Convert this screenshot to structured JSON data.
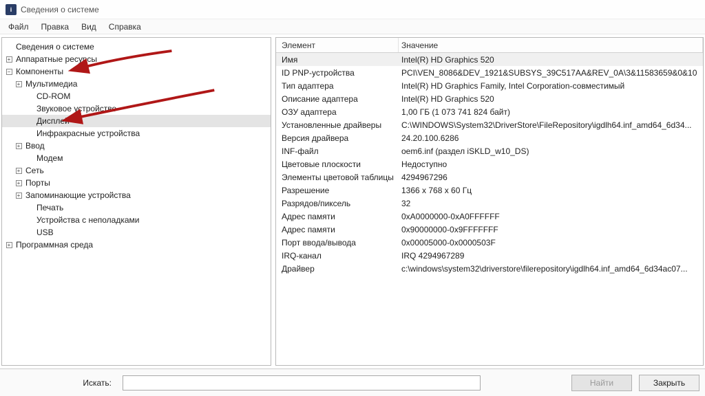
{
  "window": {
    "title": "Сведения о системе"
  },
  "menubar": {
    "file": "Файл",
    "edit": "Правка",
    "view": "Вид",
    "help": "Справка"
  },
  "tree": {
    "root": "Сведения о системе",
    "hardware": "Аппаратные ресурсы",
    "components": "Компоненты",
    "multimedia": "Мультимедиа",
    "cdrom": "CD-ROM",
    "sound": "Звуковое устройство",
    "display": "Дисплей",
    "infrared": "Инфракрасные устройства",
    "input": "Ввод",
    "modem": "Модем",
    "network": "Сеть",
    "ports": "Порты",
    "storage": "Запоминающие устройства",
    "printing": "Печать",
    "problem_devices": "Устройства с неполадками",
    "usb": "USB",
    "software_env": "Программная среда"
  },
  "detail": {
    "header_element": "Элемент",
    "header_value": "Значение",
    "rows": [
      {
        "name": "Имя",
        "value": "Intel(R) HD Graphics 520"
      },
      {
        "name": "ID PNP-устройства",
        "value": "PCI\\VEN_8086&DEV_1921&SUBSYS_39C517AA&REV_0A\\3&11583659&0&10"
      },
      {
        "name": "Тип адаптера",
        "value": "Intel(R) HD Graphics Family, Intel Corporation-совместимый"
      },
      {
        "name": "Описание адаптера",
        "value": "Intel(R) HD Graphics 520"
      },
      {
        "name": "ОЗУ адаптера",
        "value": "1,00 ГБ (1 073 741 824 байт)"
      },
      {
        "name": "Установленные драйверы",
        "value": "C:\\WINDOWS\\System32\\DriverStore\\FileRepository\\igdlh64.inf_amd64_6d34..."
      },
      {
        "name": "Версия драйвера",
        "value": "24.20.100.6286"
      },
      {
        "name": "INF-файл",
        "value": "oem6.inf (раздел iSKLD_w10_DS)"
      },
      {
        "name": "Цветовые плоскости",
        "value": "Недоступно"
      },
      {
        "name": "Элементы цветовой таблицы",
        "value": "4294967296"
      },
      {
        "name": "Разрешение",
        "value": "1366 x 768 x 60 Гц"
      },
      {
        "name": "Разрядов/пиксель",
        "value": "32"
      },
      {
        "name": "Адрес памяти",
        "value": "0xA0000000-0xA0FFFFFF"
      },
      {
        "name": "Адрес памяти",
        "value": "0x90000000-0x9FFFFFFF"
      },
      {
        "name": "Порт ввода/вывода",
        "value": "0x00005000-0x0000503F"
      },
      {
        "name": "IRQ-канал",
        "value": "IRQ 4294967289"
      },
      {
        "name": "Драйвер",
        "value": "c:\\windows\\system32\\driverstore\\filerepository\\igdlh64.inf_amd64_6d34ac07..."
      }
    ]
  },
  "footer": {
    "search_label": "Искать:",
    "search_value": "",
    "search_placeholder": "",
    "find_button": "Найти",
    "close_button": "Закрыть"
  },
  "annotations": {
    "arrow_color": "#b01717"
  }
}
